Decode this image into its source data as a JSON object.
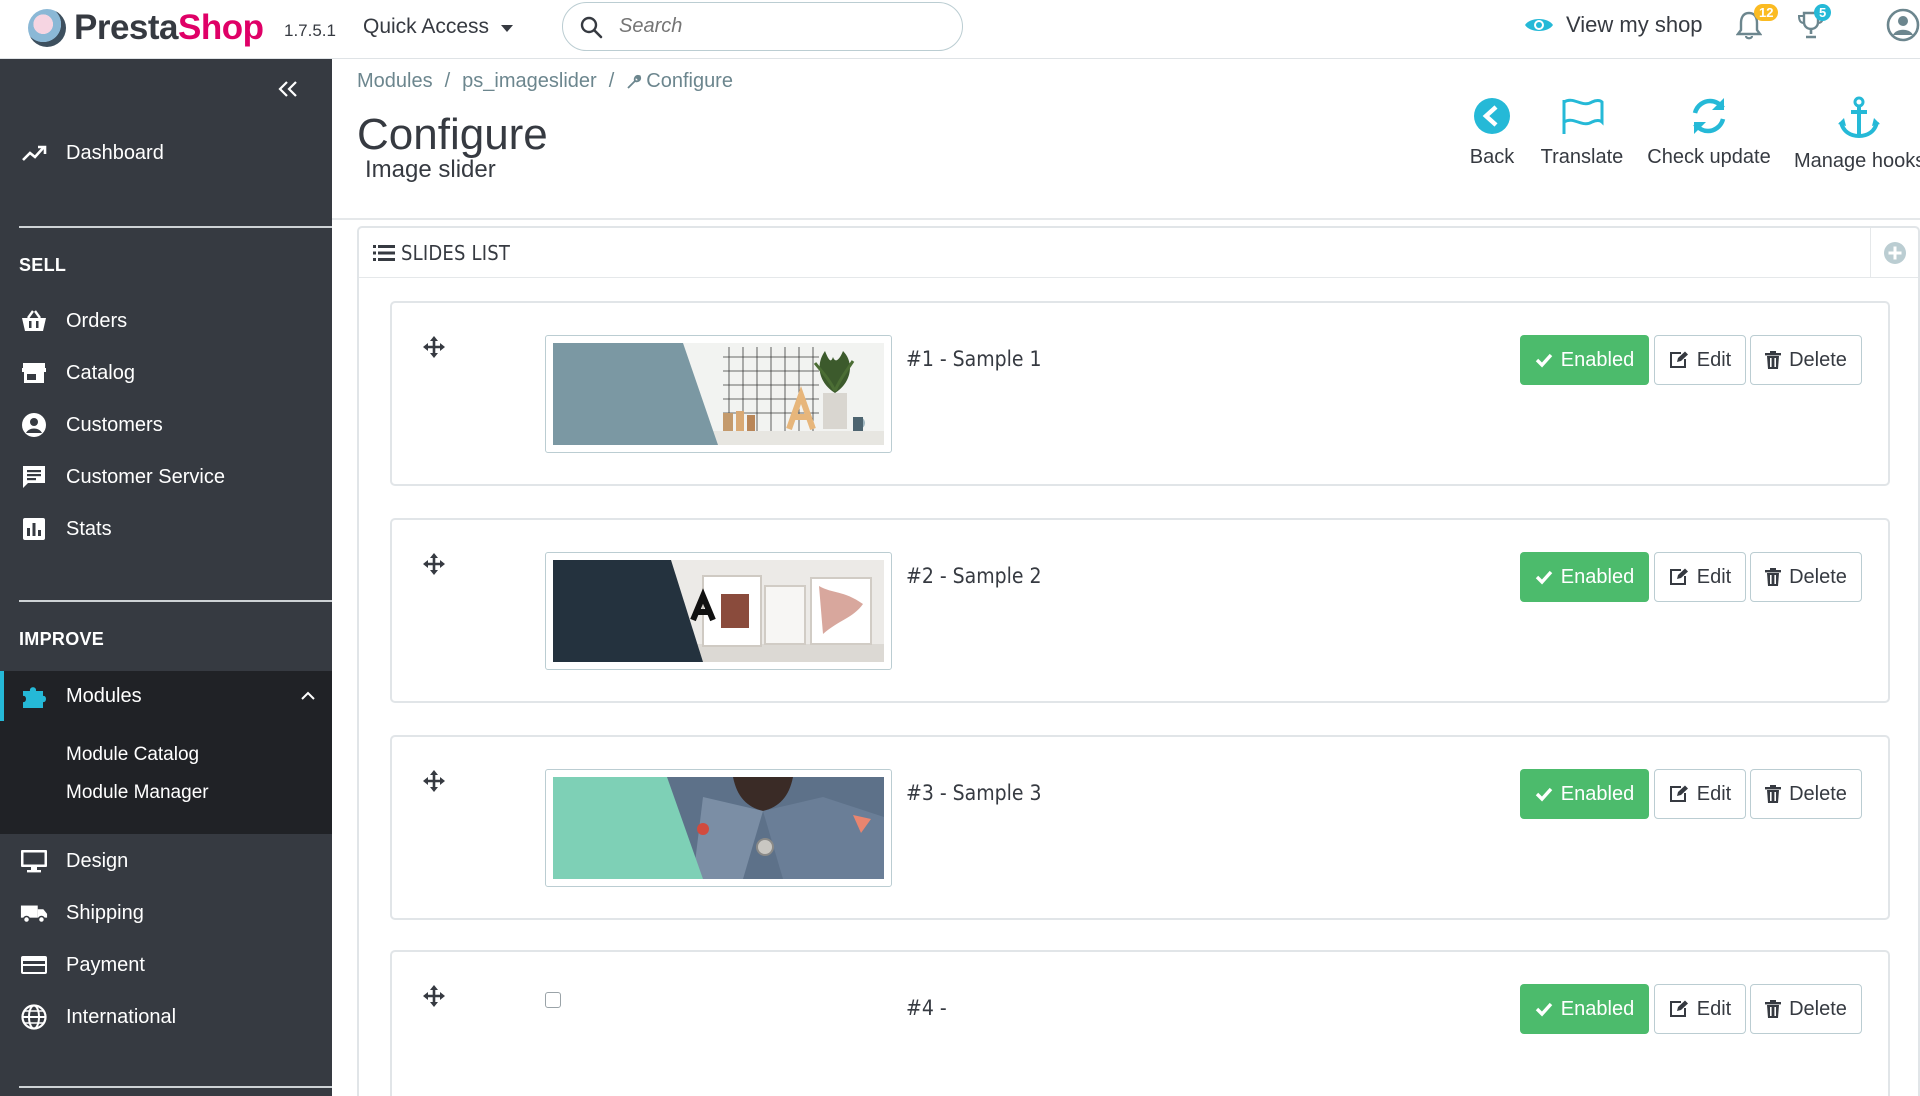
{
  "header": {
    "logo_part1": "Presta",
    "logo_part2": "Shop",
    "version": "1.7.5.1",
    "quick_access": "Quick Access",
    "search_placeholder": "Search",
    "view_shop": "View my shop",
    "notifications_count": "12",
    "orders_count": "5"
  },
  "sidebar": {
    "dashboard": "Dashboard",
    "sell_section": "SELL",
    "sell_items": [
      "Orders",
      "Catalog",
      "Customers",
      "Customer Service",
      "Stats"
    ],
    "improve_section": "IMPROVE",
    "modules": "Modules",
    "modules_sub": [
      "Module Catalog",
      "Module Manager"
    ],
    "improve_items": [
      "Design",
      "Shipping",
      "Payment",
      "International"
    ]
  },
  "breadcrumb": [
    "Modules",
    "ps_imageslider",
    "Configure"
  ],
  "page": {
    "title": "Configure",
    "subtitle": "Image slider"
  },
  "toolbar": {
    "back": "Back",
    "translate": "Translate",
    "check_update": "Check update",
    "manage_hooks": "Manage hooks"
  },
  "panel": {
    "title": "SLIDES LIST"
  },
  "slides": [
    {
      "title": "#1 - Sample 1",
      "status": "Enabled",
      "edit": "Edit",
      "delete": "Delete",
      "has_image": true
    },
    {
      "title": "#2 - Sample 2",
      "status": "Enabled",
      "edit": "Edit",
      "delete": "Delete",
      "has_image": true
    },
    {
      "title": "#3 - Sample 3",
      "status": "Enabled",
      "edit": "Edit",
      "delete": "Delete",
      "has_image": true
    },
    {
      "title": "#4 -",
      "status": "Enabled",
      "edit": "Edit",
      "delete": "Delete",
      "has_image": false
    }
  ],
  "colors": {
    "accent": "#25b9d7",
    "success": "#4cbb6c",
    "sidebar_bg": "#363a41",
    "sidebar_active_bg": "#202226",
    "brand_pink": "#df0067"
  }
}
